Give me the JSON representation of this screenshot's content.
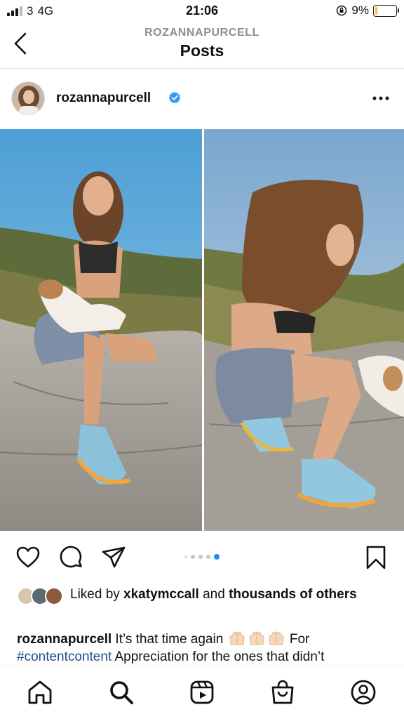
{
  "status_bar": {
    "carrier": "3",
    "network": "4G",
    "time": "21:06",
    "battery_percent_label": "9%",
    "battery_level": 0.09
  },
  "header": {
    "subtitle": "ROZANNAPURCELL",
    "title": "Posts"
  },
  "post": {
    "username": "rozannapurcell",
    "verified": true,
    "carousel": {
      "total": 5,
      "active_index": 4
    },
    "likes": {
      "prefix": "Liked by ",
      "user": "xkatymccall",
      "middle": " and ",
      "others": "thousands of others"
    },
    "caption": {
      "username": "rozannapurcell",
      "text_before": " It’s that time again ",
      "emoji": "raised-hands x3",
      "text_after": " For",
      "hashtag": "#contentcontent",
      "text_tail": " Appreciation for the ones that didn’t"
    }
  },
  "icons": {
    "back": "chevron-left-icon",
    "more": "more-horizontal-icon",
    "like": "heart-icon",
    "comment": "comment-icon",
    "share": "paper-plane-icon",
    "save": "bookmark-icon",
    "tabs": [
      "home-icon",
      "search-icon",
      "reels-icon",
      "shop-icon",
      "profile-icon"
    ]
  },
  "colors": {
    "verified_blue": "#3897f0",
    "active_dot": "#1a8cff",
    "hashtag": "#1d4e89",
    "battery_low": "#f6c21a"
  }
}
